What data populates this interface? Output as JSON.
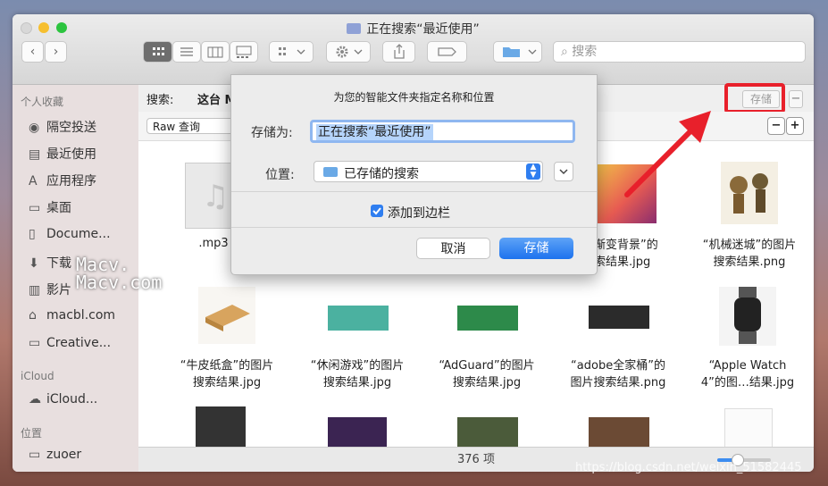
{
  "window": {
    "title": "正在搜索“最近使用”"
  },
  "toolbar": {
    "action_icon": "gear-icon",
    "share_icon": "share-icon",
    "tag_icon": "tag-icon",
    "search_placeholder": "搜索"
  },
  "sidebar": {
    "favorites_header": "个人收藏",
    "items": [
      {
        "label": "隔空投送",
        "icon": "airdrop-icon"
      },
      {
        "label": "最近使用",
        "icon": "recents-icon"
      },
      {
        "label": "应用程序",
        "icon": "applications-icon"
      },
      {
        "label": "桌面",
        "icon": "desktop-icon"
      },
      {
        "label": "Docume...",
        "icon": "documents-icon"
      },
      {
        "label": "下载",
        "icon": "download-icon"
      },
      {
        "label": "影片",
        "icon": "movies-icon"
      },
      {
        "label": "macbl.com",
        "icon": "home-icon"
      },
      {
        "label": "Creative...",
        "icon": "folder-icon"
      }
    ],
    "icloud_header": "iCloud",
    "icloud_item": "iCloud...",
    "locations_header": "位置",
    "location_item": "zuoer"
  },
  "scope": {
    "label": "搜索:",
    "this_mac": "这台 M",
    "save_label": "存储",
    "minus": "−"
  },
  "criteria": {
    "field": "Raw 查询",
    "minus": "−",
    "plus": "+"
  },
  "items": [
    {
      "label1": ".mp3",
      "label2": ""
    },
    {
      "label1": "渐变背景”的",
      "label2": "索结果.jpg"
    },
    {
      "label1": "“机械迷城”的图片",
      "label2": "搜索结果.png"
    },
    {
      "label1": "“牛皮纸盒”的图片",
      "label2": "搜索结果.jpg"
    },
    {
      "label1": "“休闲游戏”的图片",
      "label2": "搜索结果.jpg"
    },
    {
      "label1": "“AdGuard”的图片",
      "label2": "搜索结果.jpg"
    },
    {
      "label1": "“adobe全家桶”的",
      "label2": "图片搜索结果.png"
    },
    {
      "label1": "“Apple Watch",
      "label2": "4”的图…结果.jpg"
    }
  ],
  "status": {
    "count": "376 项"
  },
  "dialog": {
    "heading": "为您的智能文件夹指定名称和位置",
    "save_as_label": "存储为:",
    "save_as_value": "正在搜索“最近使用”",
    "location_label": "位置:",
    "location_value": "已存储的搜索",
    "sidebar_checkbox_label": "添加到边栏",
    "sidebar_checkbox_checked": true,
    "cancel_label": "取消",
    "save_label": "存储"
  },
  "watermarks": {
    "w1": "Macv.",
    "w2": "Macv.com",
    "url": "https://blog.csdn.net/weixin_51582445"
  },
  "colors": {
    "accent": "#1d7ef5",
    "annotation": "#e8202b"
  }
}
